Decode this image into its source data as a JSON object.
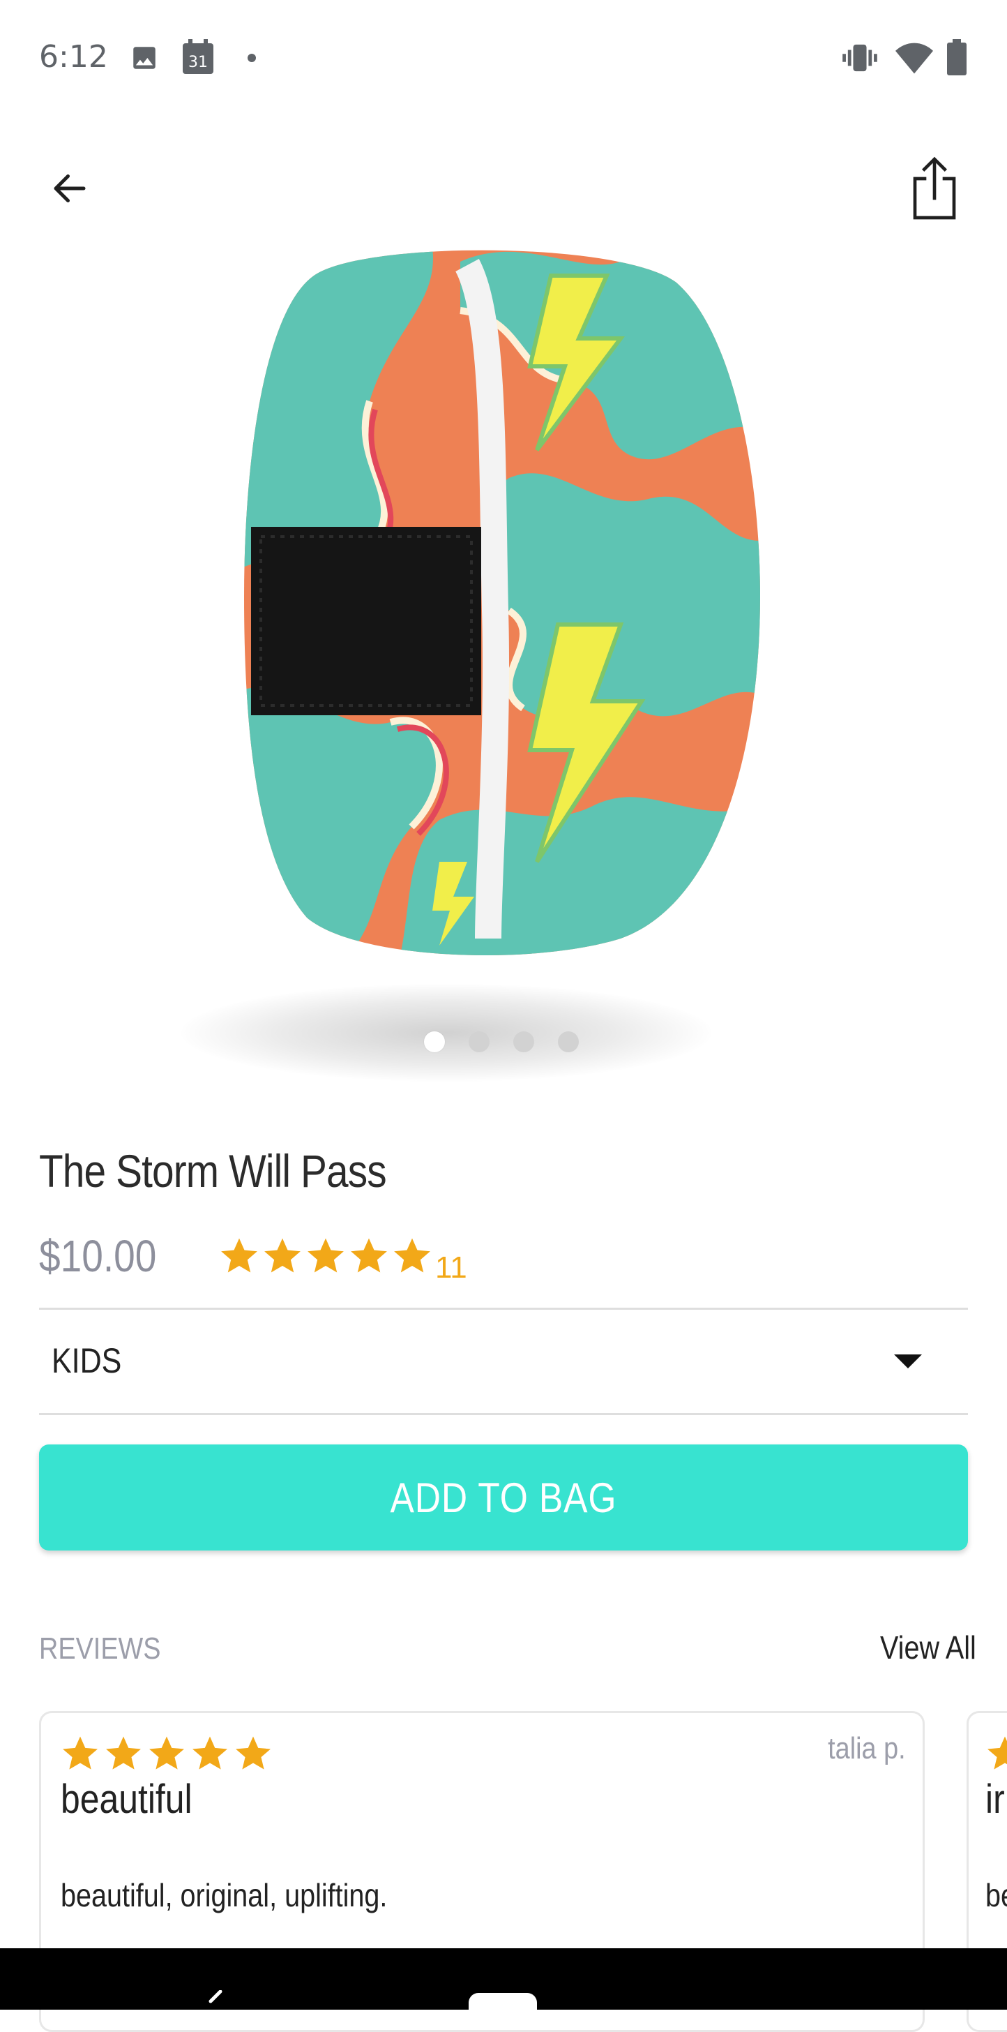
{
  "status_bar": {
    "time": "6:12",
    "calendar_day": "31",
    "icons": [
      "image-icon",
      "calendar-icon",
      "notification-dot-icon",
      "vibrate-icon",
      "wifi-icon",
      "battery-icon"
    ]
  },
  "app_bar": {
    "back_icon": "arrow-left-icon",
    "share_icon": "share-icon"
  },
  "carousel": {
    "dot_count": 4,
    "active_index": 0
  },
  "product": {
    "title": "The Storm Will Pass",
    "price": "$10.00",
    "rating": 5,
    "rating_count": "11",
    "star_color": "#f2a818"
  },
  "size_select": {
    "value": "KIDS"
  },
  "cta": {
    "label": "ADD TO BAG",
    "color": "#38e3d0"
  },
  "reviews": {
    "section_label": "REVIEWS",
    "view_all_label": "View All",
    "items": [
      {
        "stars": 5,
        "author": "talia p.",
        "title": "beautiful",
        "body": "beautiful, original, uplifting."
      },
      {
        "stars": 5,
        "author": "",
        "title": "ir",
        "body": "be"
      }
    ]
  }
}
